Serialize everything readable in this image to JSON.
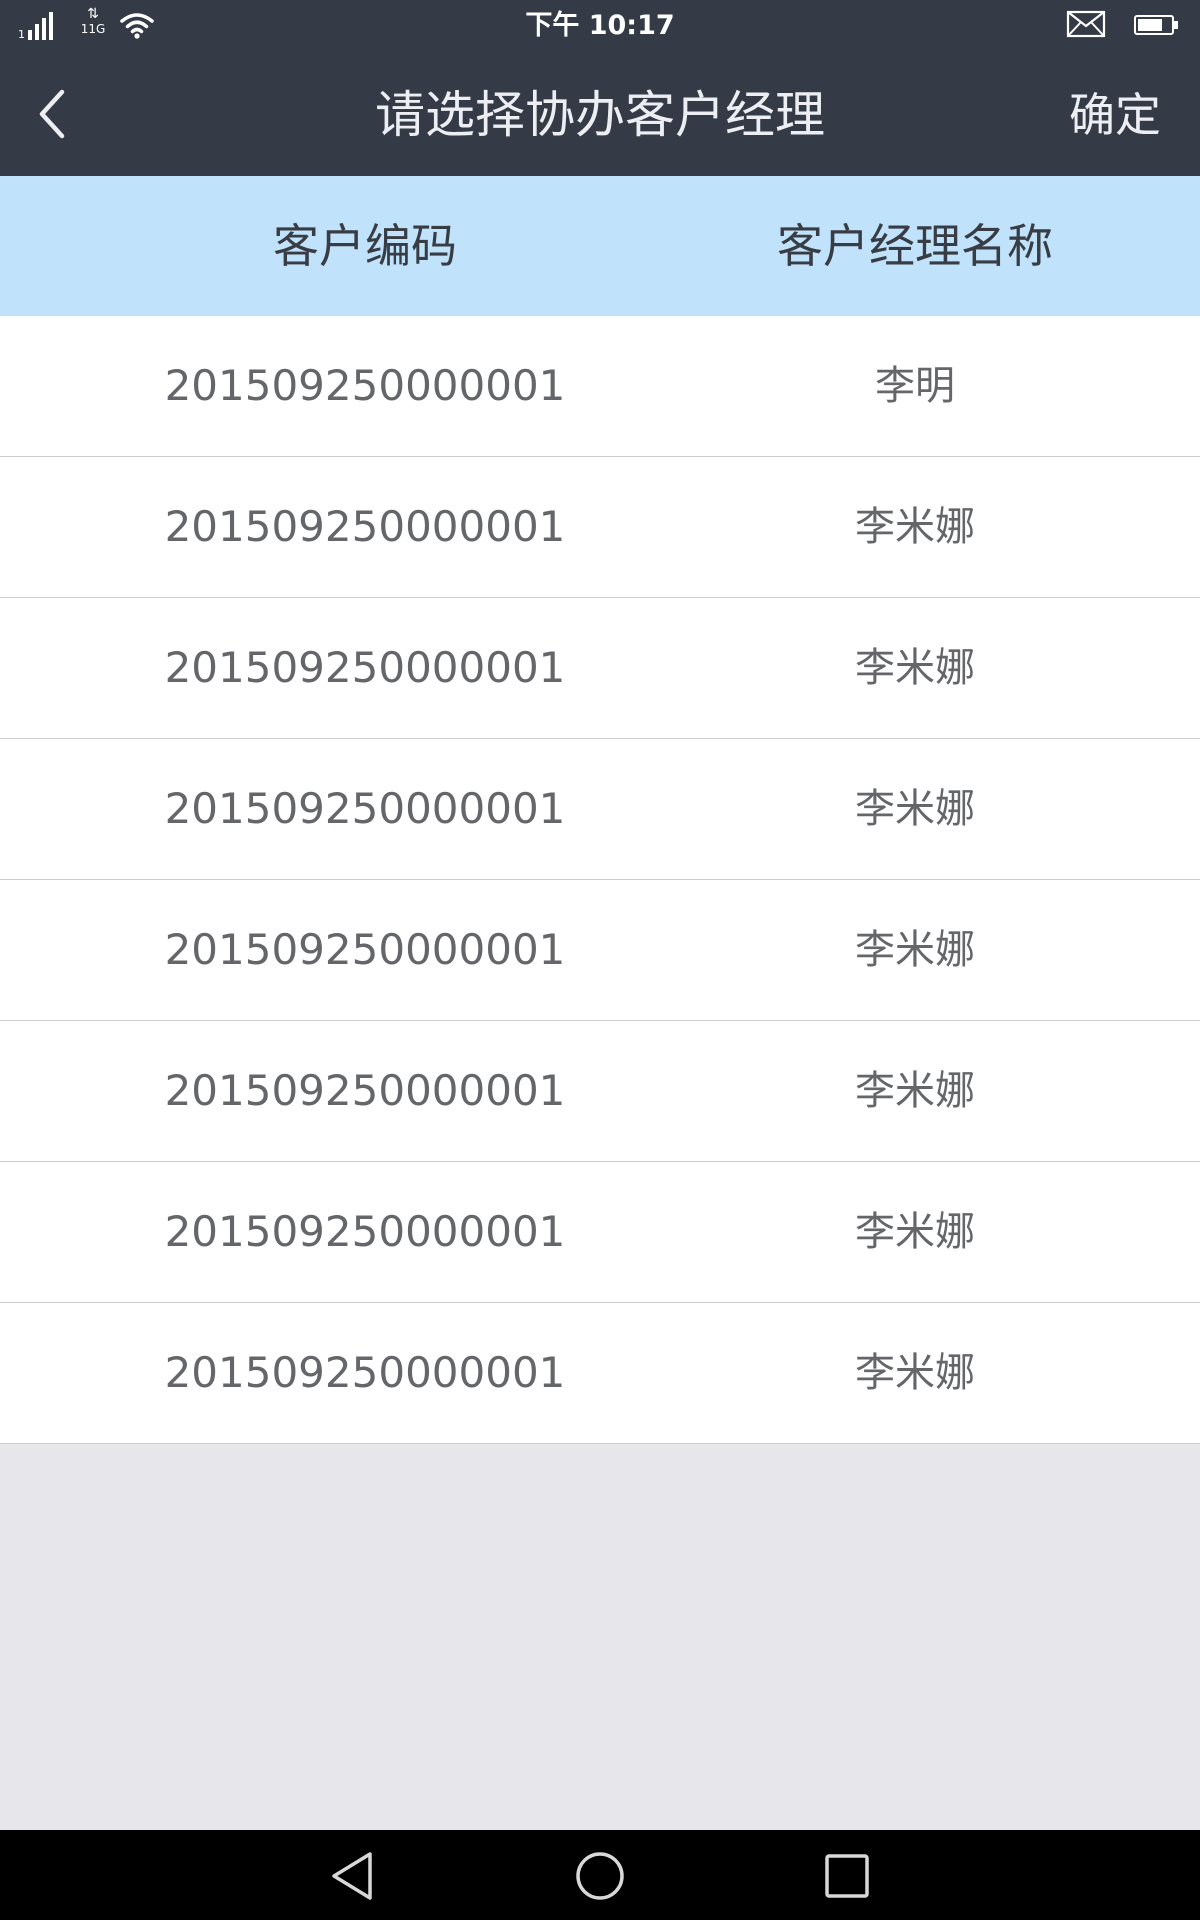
{
  "status_bar": {
    "signal_level": "1",
    "network_arrows": "⇅",
    "network_type": "11G",
    "time": "下午  10:17",
    "icons": [
      "signal-icon",
      "wifi-icon",
      "mail-icon",
      "battery-icon"
    ]
  },
  "nav_bar": {
    "title": "请选择协办客户经理",
    "confirm_label": "确定",
    "back_icon": "chevron-left-icon"
  },
  "table": {
    "columns": [
      "客户编码",
      "客户经理名称"
    ],
    "rows": [
      {
        "code": "201509250000001",
        "name": "李明"
      },
      {
        "code": "201509250000001",
        "name": "李米娜"
      },
      {
        "code": "201509250000001",
        "name": "李米娜"
      },
      {
        "code": "201509250000001",
        "name": "李米娜"
      },
      {
        "code": "201509250000001",
        "name": "李米娜"
      },
      {
        "code": "201509250000001",
        "name": "李米娜"
      },
      {
        "code": "201509250000001",
        "name": "李米娜"
      },
      {
        "code": "201509250000001",
        "name": "李米娜"
      }
    ]
  },
  "system_nav": {
    "icons": [
      "back-triangle-icon",
      "home-circle-icon",
      "recent-square-icon"
    ]
  },
  "colors": {
    "header_bg": "#343A46",
    "title_text": "#ECEEF3",
    "table_header_bg": "#C0E2FA",
    "table_header_text": "#383C44",
    "row_text": "#64666A",
    "divider": "#CDCDCD",
    "page_bg": "#E6E6EB"
  }
}
